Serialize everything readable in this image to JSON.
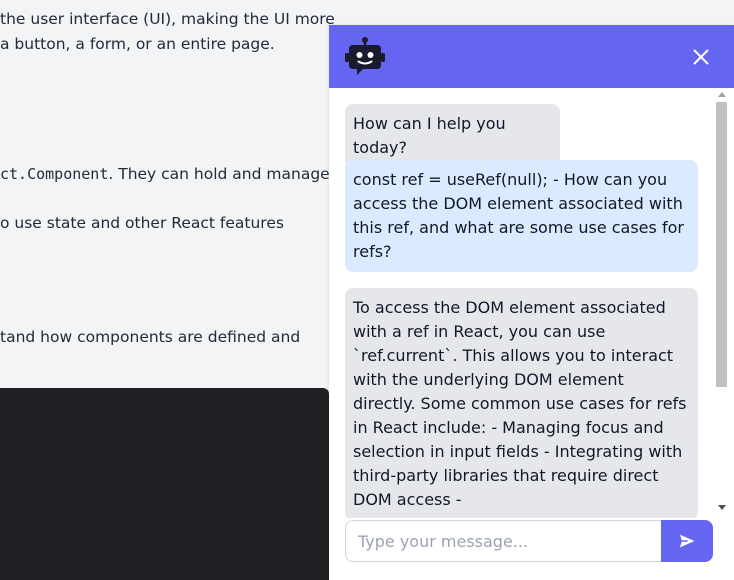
{
  "background_page": {
    "lines": [
      "the user interface (UI), making the UI more",
      " a button, a form, or an entire page.",
      "ct.Component",
      ". They can hold and manage",
      "o use state and other React features",
      "tand how components are defined and"
    ]
  },
  "chat": {
    "header": {
      "bot_icon": "robot-icon",
      "close_icon": "close-icon"
    },
    "messages": [
      {
        "role": "bot",
        "text": "How can I help you today?"
      },
      {
        "role": "user",
        "text": "const ref = useRef(null); - How can you access the DOM element associated with this ref, and what are some use cases for refs?"
      },
      {
        "role": "bot",
        "text": "To access the DOM element associated with a ref in React, you can use `ref.current`. This allows you to interact with the underlying DOM element directly. Some common use cases for refs in React include: - Managing focus and selection in input fields - Integrating with third-party libraries that require direct DOM access -"
      }
    ],
    "input": {
      "placeholder": "Type your message...",
      "value": ""
    },
    "send_icon": "send-icon"
  },
  "colors": {
    "accent": "#6466f1",
    "bot_bubble": "#e5e7eb",
    "user_bubble": "#dbeafe",
    "code_block": "#1f2023"
  }
}
